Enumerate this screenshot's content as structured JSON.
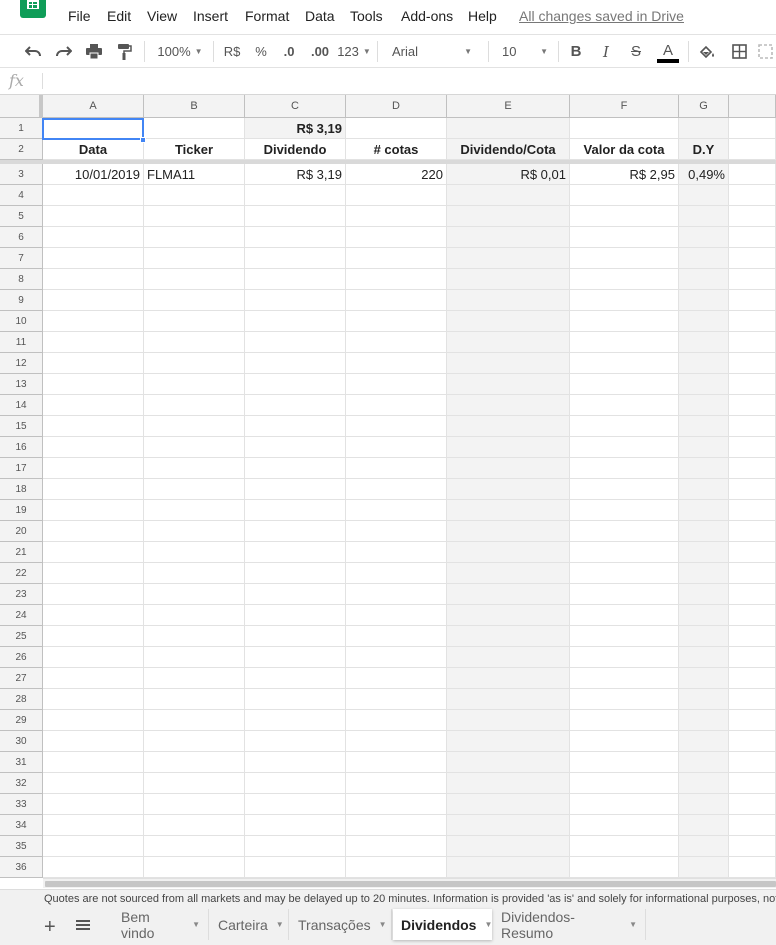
{
  "menu": {
    "items": [
      "File",
      "Edit",
      "View",
      "Insert",
      "Format",
      "Data",
      "Tools",
      "Add-ons",
      "Help"
    ],
    "save_status": "All changes saved in Drive"
  },
  "toolbar": {
    "zoom": "100%",
    "currency": "R$",
    "percent": "%",
    "decrease_decimal": ".0",
    "increase_decimal": ".00",
    "more_formats": "123",
    "font": "Arial",
    "font_size": "10",
    "bold": "B",
    "italic": "I",
    "strikethrough": "S",
    "text_color_letter": "A"
  },
  "formula_bar": {
    "fx": "fx",
    "value": ""
  },
  "grid": {
    "columns": [
      "A",
      "B",
      "C",
      "D",
      "E",
      "F",
      "G"
    ],
    "row_count": 36,
    "rows": [
      [
        "",
        "",
        "R$ 3,19",
        "",
        "",
        "",
        ""
      ],
      [
        "Data",
        "Ticker",
        "Dividendo",
        "# cotas",
        "Dividendo/Cota",
        "Valor da cota",
        "D.Y"
      ],
      [
        "10/01/2019",
        "FLMA11",
        "R$ 3,19",
        "220",
        "R$ 0,01",
        "R$ 2,95",
        "0,49%"
      ]
    ],
    "selected_cell": "A1"
  },
  "disclaimer": "Quotes are not sourced from all markets and may be delayed up to 20 minutes. Information is provided 'as is' and solely for informational purposes, not",
  "sheet_tabs": [
    "Bem vindo",
    "Carteira",
    "Transações",
    "Dividendos",
    "Dividendos-Resumo"
  ],
  "active_tab": "Dividendos",
  "colors": {
    "selection": "#4285f4",
    "sheets_green": "#0f9d58"
  }
}
